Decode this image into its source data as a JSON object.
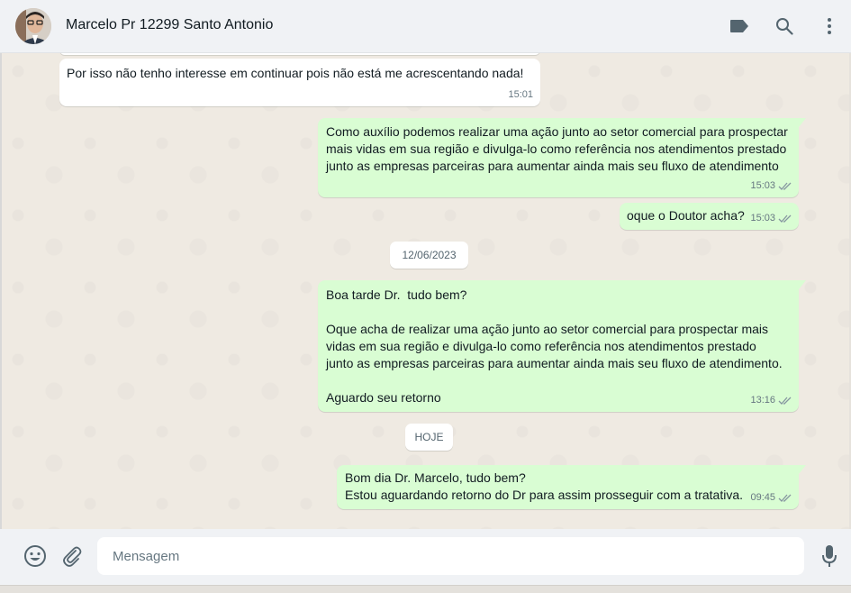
{
  "header": {
    "contact_name": "Marcelo Pr 12299 Santo Antonio",
    "icons": [
      "label-icon",
      "search-icon",
      "more-vertical-icon"
    ]
  },
  "messages": [
    {
      "direction": "in",
      "text": "Por isso não tenho interesse em continuar pois não está me acrescentando nada!",
      "time": "15:01"
    },
    {
      "direction": "out",
      "text": "Como auxílio podemos realizar uma ação junto ao setor comercial para prospectar\nmais vidas em sua região e divulga-lo como referência nos atendimentos prestado\njunto as empresas parceiras para aumentar ainda mais seu fluxo de atendimento",
      "time": "15:03",
      "status": "read"
    },
    {
      "direction": "out",
      "text": "oque o Doutor acha?",
      "time": "15:03",
      "status": "read"
    },
    {
      "direction": "out",
      "text": "Boa tarde Dr.  tudo bem?\n\nOque acha de realizar uma ação junto ao setor comercial para prospectar mais\nvidas em sua região e divulga-lo como referência nos atendimentos prestado\njunto as empresas parceiras para aumentar ainda mais seu fluxo de atendimento.\n\nAguardo seu retorno",
      "time": "13:16",
      "status": "read"
    },
    {
      "direction": "out",
      "text": "Bom dia Dr. Marcelo, tudo bem?\nEstou aguardando retorno do Dr para assim prosseguir com a tratativa.",
      "time": "09:45",
      "status": "read"
    }
  ],
  "date_separators": [
    "12/06/2023",
    "HOJE"
  ],
  "composer": {
    "placeholder": "Mensagem",
    "value": "",
    "icons": [
      "emoji-icon",
      "attach-icon",
      "microphone-icon"
    ]
  },
  "colors": {
    "outgoing_bubble": "#d9fdd3",
    "incoming_bubble": "#ffffff",
    "chat_background": "#efeae2",
    "header_background": "#f0f2f5",
    "tick_color": "#8696a0"
  }
}
